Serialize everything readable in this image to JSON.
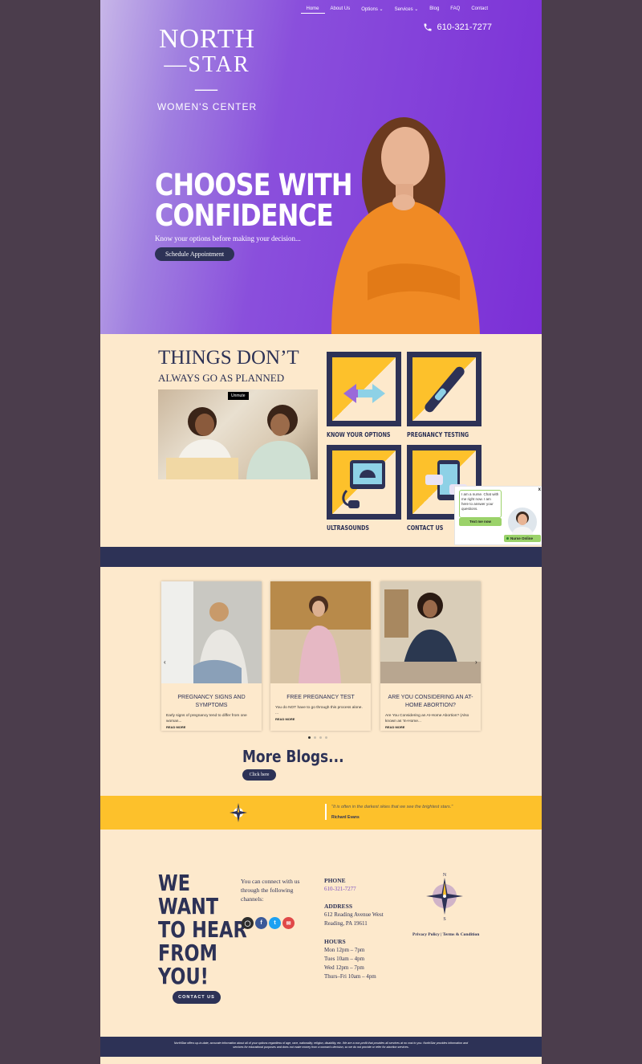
{
  "nav": {
    "items": [
      {
        "label": "Home",
        "active": true
      },
      {
        "label": "About Us"
      },
      {
        "label": "Options ⌄"
      },
      {
        "label": "Services ⌄"
      },
      {
        "label": "Blog"
      },
      {
        "label": "FAQ"
      },
      {
        "label": "Contact"
      }
    ]
  },
  "header": {
    "phone": "610-321-7277"
  },
  "logo": {
    "line1": "NORTH",
    "line2": "—STAR—",
    "line3": "WOMEN'S CENTER"
  },
  "hero": {
    "headline_1": "CHOOSE WITH",
    "headline_2": "CONFIDENCE",
    "subline": "Know your options before making your decision...",
    "cta": "Schedule Appointment"
  },
  "things": {
    "title": "THINGS DON’T",
    "subtitle": "ALWAYS GO AS PLANNED",
    "unmute": "Unmute",
    "tiles": [
      {
        "label": "KNOW YOUR OPTIONS"
      },
      {
        "label": "PREGNANCY TESTING"
      },
      {
        "label": "ULTRASOUNDS"
      },
      {
        "label": "CONTACT US"
      }
    ]
  },
  "chat": {
    "message": "I am a nurse. Chat with me right now. I am here to answer your questions.",
    "button": "Text me now",
    "status": "Nurse Online",
    "close": "x"
  },
  "blogs": {
    "posts": [
      {
        "title": "PREGNANCY SIGNS AND SYMPTOMS",
        "excerpt": "Early signs of pregnancy tend to differ from one woman...",
        "more": "READ MORE"
      },
      {
        "title": "FREE PREGNANCY TEST",
        "excerpt": "You do NOT have to go through this process alone. ...",
        "more": "READ MORE"
      },
      {
        "title": "ARE YOU CONSIDERING AN AT-HOME ABORTION?",
        "excerpt": "Are You Considering an At-Home Abortion? (Also known as 'In-Home...",
        "more": "READ MORE"
      }
    ],
    "more_title": "More Blogs...",
    "more_button": "Click here"
  },
  "quote": {
    "text": "\"It is often in the darkest skies that we see the brightest stars.\"",
    "author": "Richard Evans"
  },
  "contact": {
    "heading": [
      "WE",
      "WANT",
      "TO HEAR",
      "FROM",
      "YOU!"
    ],
    "button": "CONTACT US",
    "connect": "You can connect with us through the following channels:",
    "phone_h": "PHONE",
    "phone": "610-321-7277",
    "address_h": "ADDRESS",
    "address_1": "612 Reading Avenue West",
    "address_2": "Reading, PA 19611",
    "hours_h": "HOURS",
    "hours": [
      "Mon 12pm – 7pm",
      "Tues 10am – 4pm",
      "Wed 12pm – 7pm",
      "Thurs–Fri 10am – 4pm"
    ],
    "privacy": "Privacy Policy | Terms & Condition"
  },
  "footer": {
    "text": "NorthStar offers up-to-date, accurate information about all of your options regardless of age, race, nationality, religion, disability, etc. We are a non-profit that provides all services at no cost to you. NorthStar provides information and services for educational purposes and does not make money from a woman's decision, so we do not provide or refer for abortion services."
  },
  "colors": {
    "navy": "#2d3256",
    "purple": "#7b2fd6",
    "yellow": "#fdc12b",
    "cream": "#fde9cc",
    "background": "#4b3d4c"
  }
}
